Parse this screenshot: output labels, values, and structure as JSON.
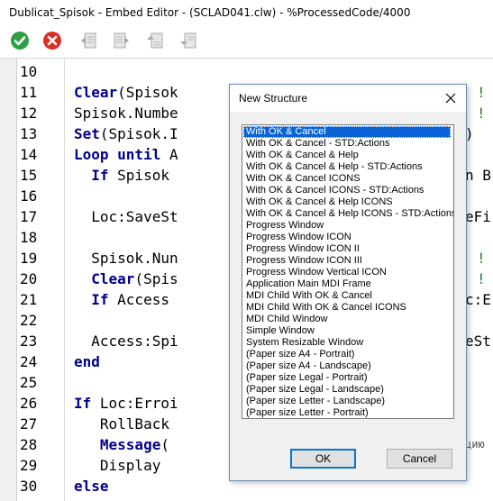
{
  "window": {
    "title": "Dublicat_Spisok - Embed Editor - (SCLAD041.clw) - %ProcessedCode/4000"
  },
  "toolbar": {
    "icons": [
      "check-icon",
      "cancel-icon",
      "nav-prev-icon",
      "nav-next-icon",
      "nav-up-icon",
      "nav-down-icon"
    ],
    "colors": {
      "ok": "#2ea043",
      "cancel": "#d93025"
    }
  },
  "editor": {
    "lines": [
      {
        "num": "10",
        "kw": "",
        "text": ""
      },
      {
        "num": "11",
        "kw": "Clear",
        "text": "(Spisok"
      },
      {
        "num": "12",
        "kw": "",
        "text": "Spisok.Numbe"
      },
      {
        "num": "13",
        "kw": "Set",
        "text": "(Spisok.I"
      },
      {
        "num": "14",
        "kw": "Loop until",
        "text": " A"
      },
      {
        "num": "15",
        "kw": "  If",
        "text": " Spisok"
      },
      {
        "num": "16",
        "kw": "",
        "text": ""
      },
      {
        "num": "17",
        "kw": "",
        "text": "  Loc:SaveSt"
      },
      {
        "num": "18",
        "kw": "",
        "text": ""
      },
      {
        "num": "19",
        "kw": "",
        "text": "  Spisok.Nun"
      },
      {
        "num": "20",
        "kw": "  Clear",
        "text": "(Spis"
      },
      {
        "num": "21",
        "kw": "  If",
        "text": " Access"
      },
      {
        "num": "22",
        "kw": "",
        "text": ""
      },
      {
        "num": "23",
        "kw": "",
        "text": "  Access:Spi"
      },
      {
        "num": "24",
        "kw": "end",
        "text": ""
      },
      {
        "num": "25",
        "kw": "",
        "text": ""
      },
      {
        "num": "26",
        "kw": "If",
        "text": " Loc:Erroi"
      },
      {
        "num": "27",
        "kw": "",
        "text": "   RollBack"
      },
      {
        "num": "28",
        "kw": "   Message",
        "text": "("
      },
      {
        "num": "29",
        "kw": "",
        "text": "   Display"
      },
      {
        "num": "30",
        "kw": "else",
        "text": ""
      }
    ],
    "right_fragments": [
      {
        "line": 1,
        "text": "!"
      },
      {
        "line": 2,
        "text": "!"
      },
      {
        "line": 3,
        "text": ")"
      },
      {
        "line": 5,
        "text": "n B"
      },
      {
        "line": 7,
        "text": "eFi"
      },
      {
        "line": 9,
        "text": "!"
      },
      {
        "line": 10,
        "text": "!"
      },
      {
        "line": 11,
        "text": "c:E"
      },
      {
        "line": 13,
        "text": "eSt"
      },
      {
        "line": 18,
        "text": "цию"
      }
    ]
  },
  "dialog": {
    "title": "New Structure",
    "items": [
      "With OK & Cancel",
      "With OK & Cancel - STD:Actions",
      "With OK & Cancel & Help",
      "With OK & Cancel & Help - STD:Actions",
      "With OK & Cancel ICONS",
      "With OK & Cancel ICONS - STD:Actions",
      "With OK & Cancel & Help ICONS",
      "With OK & Cancel & Help ICONS - STD:Actions",
      "Progress Window",
      "Progress Window ICON",
      "Progress Window ICON II",
      "Progress Window ICON III",
      "Progress Window Vertical ICON",
      "Application Main MDI Frame",
      "MDI Child With OK & Cancel",
      "MDI Child With OK & Cancel ICONS",
      "MDI Child Window",
      "Simple Window",
      "System Resizable Window",
      "(Paper size A4 - Portrait)",
      "(Paper size A4 - Landscape)",
      "(Paper size Legal - Portrait)",
      "(Paper size Legal - Landscape)",
      "(Paper size Letter - Landscape)",
      "(Paper size Letter - Portrait)"
    ],
    "selected_index": 0,
    "ok_label": "OK",
    "cancel_label": "Cancel",
    "colors": {
      "selection": "#0a64d6"
    }
  }
}
